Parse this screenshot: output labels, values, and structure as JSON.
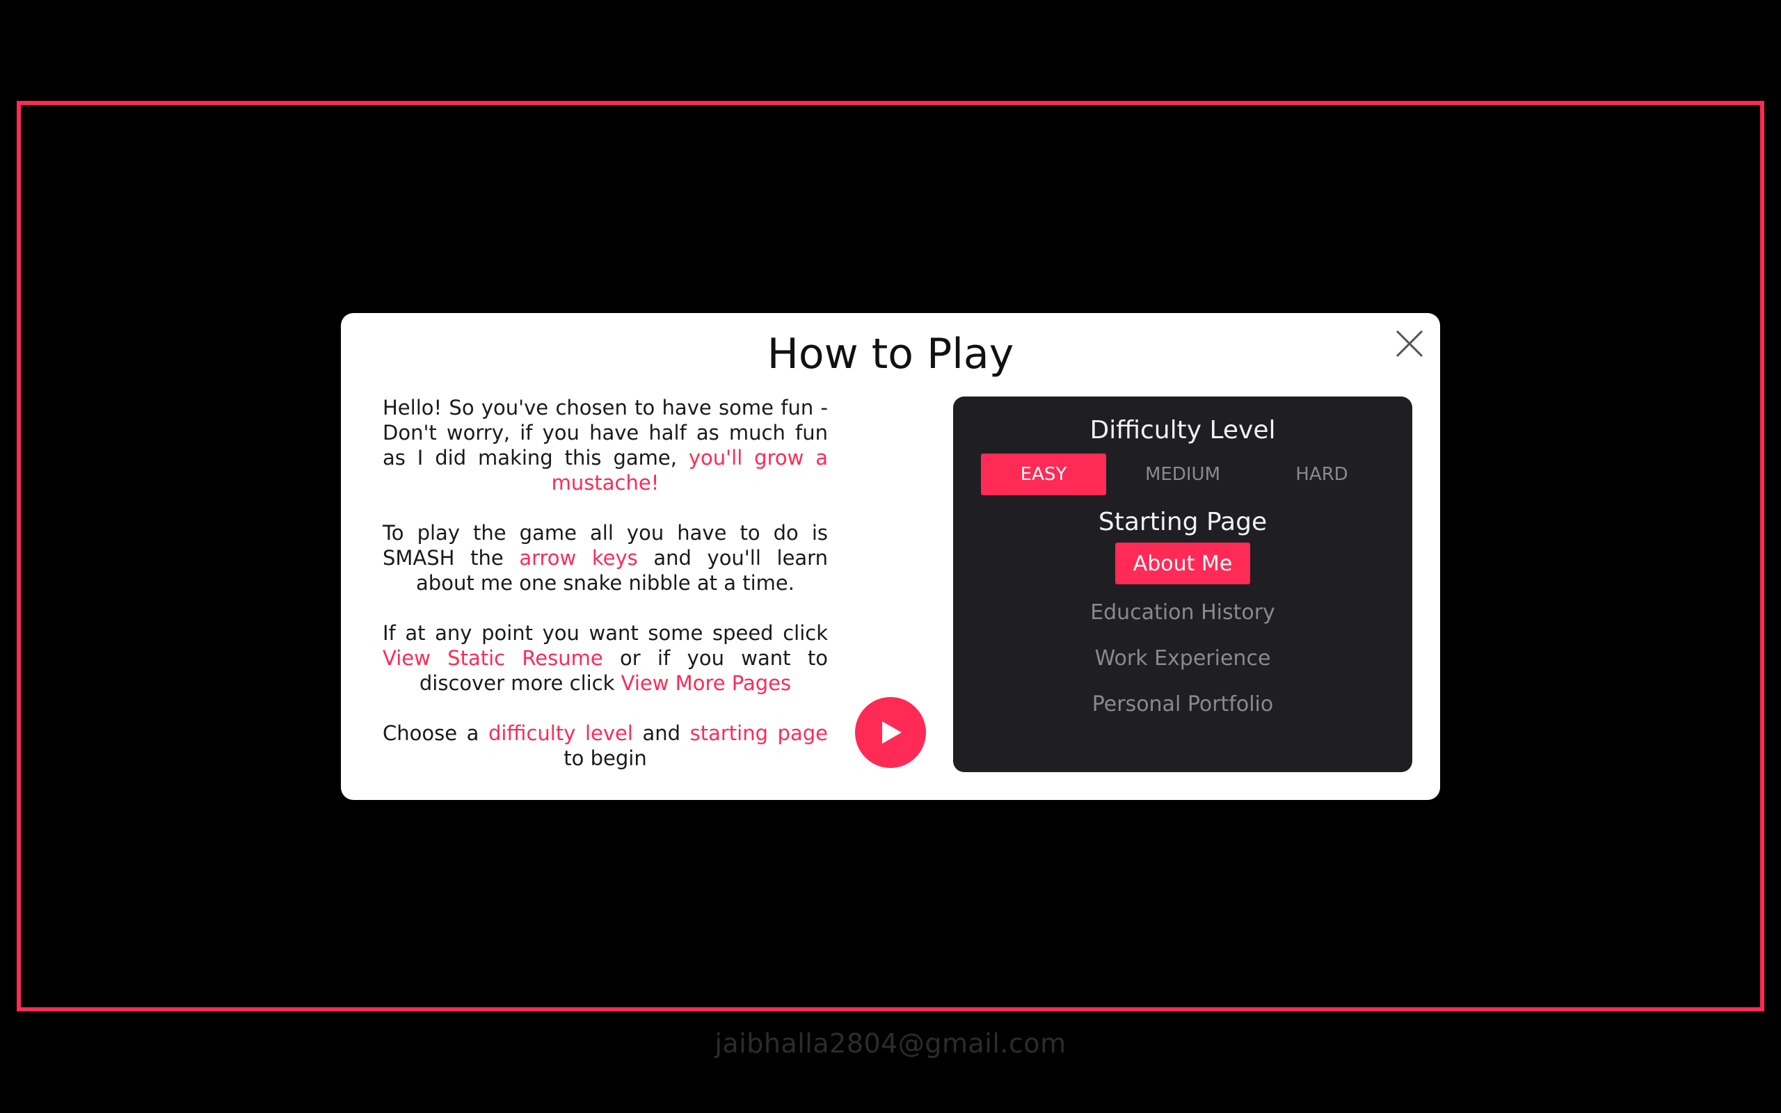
{
  "modal": {
    "title": "How to Play",
    "paragraphs": {
      "p1": {
        "text": "Hello! So you've chosen to have some fun - Don't worry, if you have half as much fun as I did making this game, ",
        "highlight": "you'll grow a mustache!"
      },
      "p2": {
        "pre": "To play the game all you have to do is SMASH the ",
        "highlight": "arrow keys",
        "post": " and you'll learn about me one snake nibble at a time."
      },
      "p3": {
        "pre": "If at any point you want some speed click ",
        "link1": "View Static Resume",
        "mid": " or if you want to discover more click ",
        "link2": "View More Pages"
      },
      "p4": {
        "pre": "Choose a ",
        "link1": "difficulty level",
        "mid": " and ",
        "link2": "starting page",
        "post": " to begin"
      }
    },
    "close_icon": "close-x-icon",
    "play_icon": "play-triangle-icon"
  },
  "settings": {
    "difficulty_heading": "Difficulty Level",
    "difficulty_options": [
      {
        "label": "EASY",
        "selected": true
      },
      {
        "label": "MEDIUM",
        "selected": false
      },
      {
        "label": "HARD",
        "selected": false
      }
    ],
    "starting_heading": "Starting Page",
    "page_options": [
      {
        "label": "About Me",
        "selected": true
      },
      {
        "label": "Education History",
        "selected": false
      },
      {
        "label": "Work Experience",
        "selected": false
      },
      {
        "label": "Personal Portfolio",
        "selected": false
      }
    ]
  },
  "footer": {
    "email": "jaibhalla2804@gmail.com"
  },
  "colors": {
    "accent": "#ff2a55",
    "background": "#000000",
    "panel": "#1f1f23",
    "muted_text": "#8a8a8e"
  }
}
